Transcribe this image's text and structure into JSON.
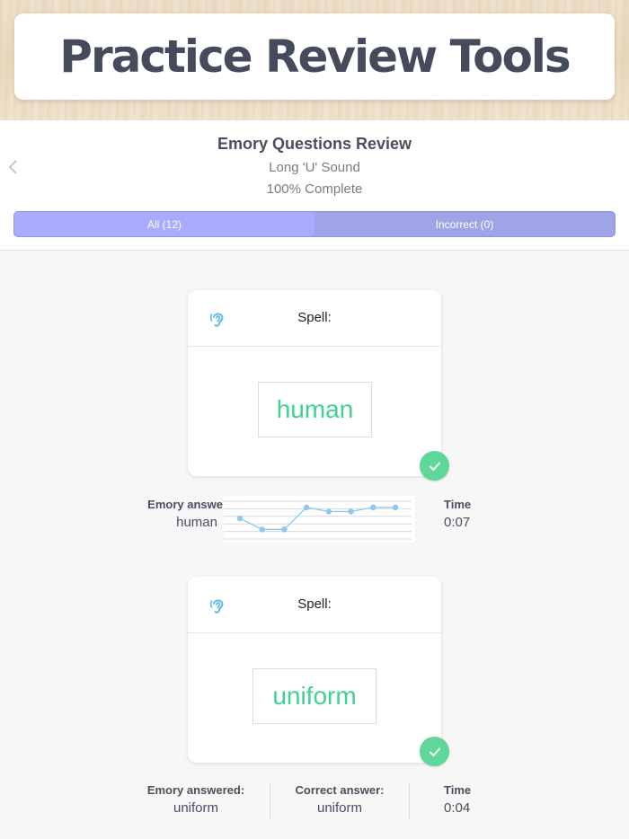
{
  "banner": {
    "title": "Practice Review Tools"
  },
  "header": {
    "title": "Emory Questions Review",
    "subtitle": "Long 'U' Sound",
    "progress": "100% Complete",
    "back_icon": "chevron-left-icon"
  },
  "tabs": [
    {
      "label": "All (12)",
      "active": true
    },
    {
      "label": "Incorrect (0)",
      "active": false
    }
  ],
  "questions": [
    {
      "prompt": "Spell:",
      "word": "human",
      "result": "correct",
      "answered_label": "Emory answe",
      "answered_value": "human",
      "time_label": "Time",
      "time_value": "0:07"
    },
    {
      "prompt": "Spell:",
      "word": "uniform",
      "result": "correct",
      "answered_label": "Emory answered:",
      "answered_value": "uniform",
      "correct_label": "Correct answer:",
      "correct_value": "uniform",
      "time_label": "Time",
      "time_value": "0:04"
    }
  ],
  "colors": {
    "accent": "#a8abff",
    "correct_green": "#3ed38f",
    "badge_green": "#5fd69a",
    "ear_icon": "#5bbde6",
    "sparkline": "#8ec8f0"
  },
  "chart_data": {
    "type": "line",
    "x": [
      1,
      2,
      3,
      4,
      5,
      6,
      7,
      8
    ],
    "values": [
      3,
      1.4,
      1.4,
      4.6,
      4,
      4,
      4.6,
      4.6
    ],
    "ylim": [
      0,
      5.5
    ],
    "grid": true
  }
}
